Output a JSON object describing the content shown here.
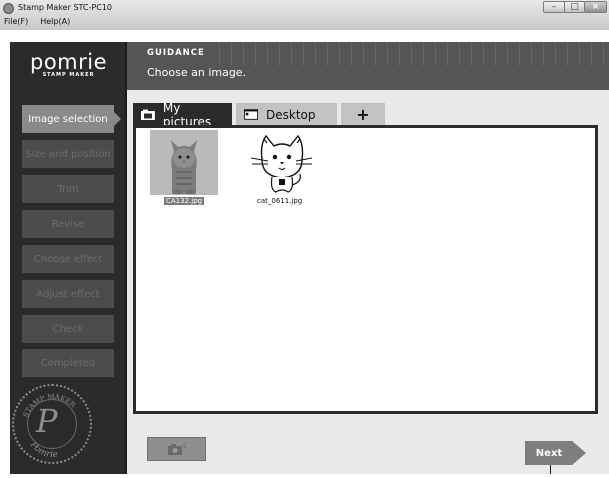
{
  "window": {
    "title": "Stamp Maker STC-PC10",
    "menu": [
      "File(F)",
      "Help(A)"
    ],
    "controls": {
      "minimize": "–",
      "maximize": "□",
      "close": "×"
    }
  },
  "sidebar": {
    "logo": {
      "name": "pomrie",
      "tagline": "STAMP MAKER"
    },
    "steps": [
      {
        "label": "Image selection",
        "active": true
      },
      {
        "label": "Size and position",
        "active": false
      },
      {
        "label": "Trim",
        "active": false
      },
      {
        "label": "Revise",
        "active": false
      },
      {
        "label": "Choose effect",
        "active": false
      },
      {
        "label": "Adjust effect",
        "active": false
      },
      {
        "label": "Check",
        "active": false
      },
      {
        "label": "Completed",
        "active": false
      }
    ],
    "seal": {
      "ring_text": "STAMP MAKER",
      "bottom_text": "Pomrie",
      "letter": "P"
    }
  },
  "guidance": {
    "label": "GUIDANCE",
    "text": "Choose an image."
  },
  "tabs": {
    "items": [
      {
        "label": "My pictures",
        "icon": "pictures-folder-icon",
        "active": true
      },
      {
        "label": "Desktop",
        "icon": "desktop-icon",
        "active": false
      },
      {
        "label": "+",
        "icon": "add-icon",
        "active": false
      }
    ]
  },
  "images": [
    {
      "filename": "CA132.jpg",
      "selected": true,
      "icon": "cat-photo-thumbnail"
    },
    {
      "filename": "cat_0611.jpg",
      "selected": false,
      "icon": "cat-drawing-thumbnail"
    }
  ],
  "buttons": {
    "camera": {
      "icon": "camera-icon"
    },
    "next": {
      "label": "Next"
    }
  },
  "colors": {
    "sidebar_bg": "#2b2b2b",
    "active_step": "#8a8a8a",
    "inactive_step": "#4c4c4c",
    "guidance_bg": "#555555",
    "content_bg": "#e9e9e9"
  }
}
